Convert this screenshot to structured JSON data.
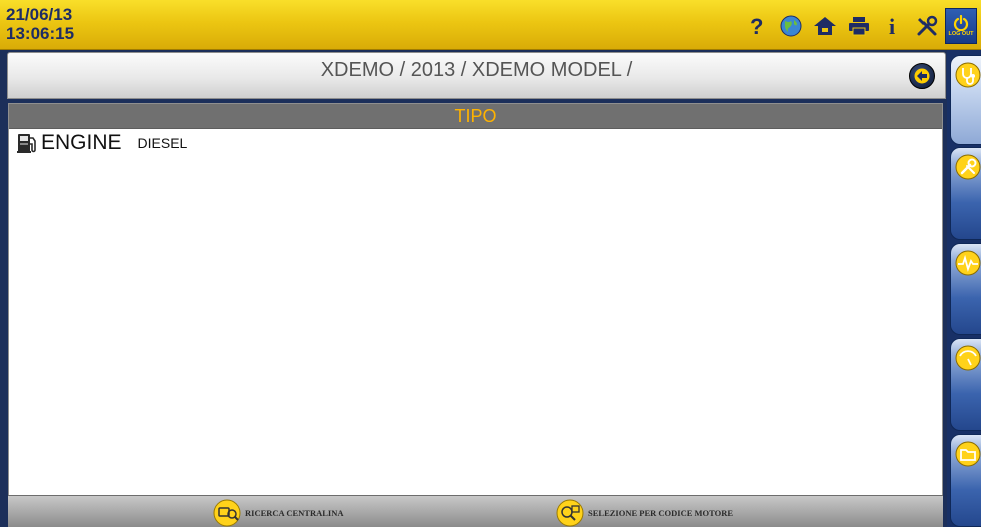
{
  "header": {
    "date": "21/06/13",
    "time": "13:06:15",
    "toolbar": [
      {
        "icon": "help-icon"
      },
      {
        "icon": "globe-icon"
      },
      {
        "icon": "home-icon"
      },
      {
        "icon": "print-icon"
      },
      {
        "icon": "info-icon"
      },
      {
        "icon": "tools-icon"
      }
    ],
    "logout_label": "LOG OUT"
  },
  "breadcrumb": "XDEMO / 2013 / XDEMO MODEL /",
  "table": {
    "header": "TIPO",
    "rows": [
      {
        "icon": "fuel-pump-icon",
        "name": "ENGINE",
        "value": "DIESEL"
      }
    ]
  },
  "bottom_buttons": [
    {
      "icon": "ecu-search-icon",
      "label": "RICERCA CENTRALINA"
    },
    {
      "icon": "engine-code-icon",
      "label": "SELEZIONE PER CODICE MOTORE"
    }
  ],
  "sidebar": [
    {
      "icon": "stethoscope-icon",
      "active": true
    },
    {
      "icon": "wrench-icon",
      "active": false
    },
    {
      "icon": "oscilloscope-icon",
      "active": false
    },
    {
      "icon": "gauge-icon",
      "active": false
    },
    {
      "icon": "folder-icon",
      "active": false
    }
  ],
  "colors": {
    "topbar": "#ecc612",
    "accent_text": "#ffb300",
    "sidebar": "#183066"
  }
}
